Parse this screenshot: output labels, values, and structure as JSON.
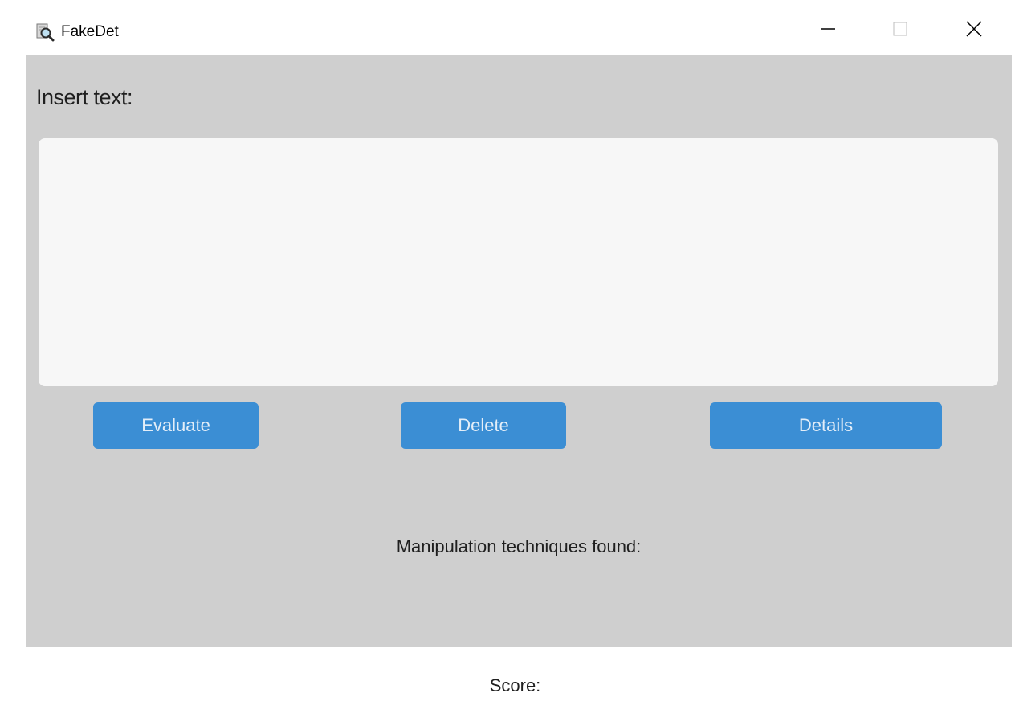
{
  "window": {
    "title": "FakeDet",
    "icon": "magnifier-document-icon",
    "controls": {
      "minimize": "minimize-icon",
      "maximize": "maximize-icon",
      "close": "close-icon"
    }
  },
  "main": {
    "insert_label": "Insert text:",
    "text_value": "",
    "buttons": {
      "evaluate": "Evaluate",
      "delete": "Delete",
      "details": "Details"
    },
    "manipulation_label": "Manipulation techniques found:"
  },
  "footer": {
    "score_label": "Score:"
  },
  "colors": {
    "panel_bg": "#cfcfcf",
    "input_bg": "#f7f7f7",
    "button_bg": "#3b8ed4",
    "button_text": "#e4eef8"
  }
}
